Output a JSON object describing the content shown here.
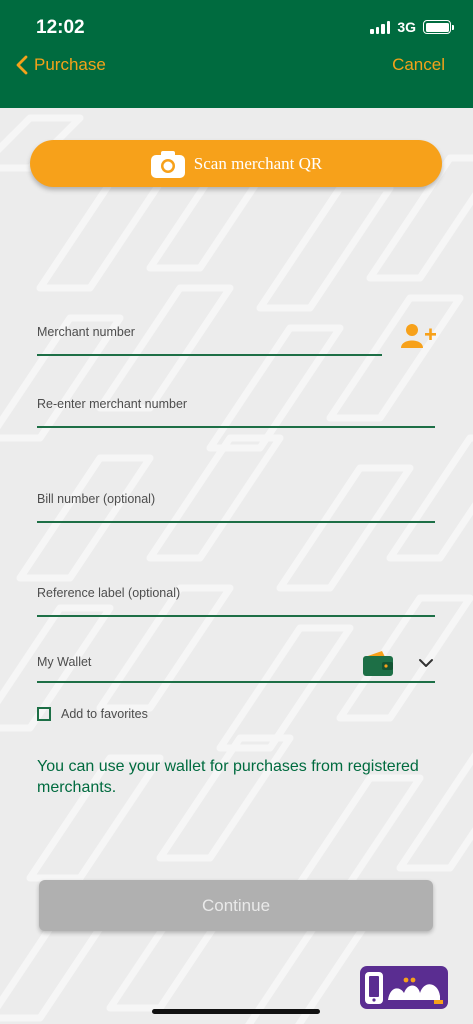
{
  "status_bar": {
    "time": "12:02",
    "network": "3G"
  },
  "nav": {
    "back_label": "Purchase",
    "cancel_label": "Cancel"
  },
  "scan": {
    "label": "Scan merchant QR"
  },
  "form": {
    "merchant_number_label": "Merchant number",
    "reenter_label": "Re-enter merchant number",
    "bill_label": "Bill number (optional)",
    "reference_label": "Reference label (optional)",
    "wallet_label": "My Wallet",
    "favorites_label": "Add to favorites",
    "favorites_checked": false
  },
  "info_text": "You can use your wallet for purchases from registered merchants.",
  "continue_label": "Continue",
  "logo": {
    "text": "meeza"
  },
  "colors": {
    "header_green": "#006b3f",
    "accent_orange": "#f7a11a",
    "field_line_green": "#1d6f46",
    "disabled_button": "#b0b0b0",
    "meeza_purple": "#5a2d91"
  },
  "icons": [
    "chevron-left-icon",
    "camera-icon",
    "add-contact-icon",
    "wallet-icon",
    "chevron-down-icon",
    "checkbox-icon"
  ]
}
